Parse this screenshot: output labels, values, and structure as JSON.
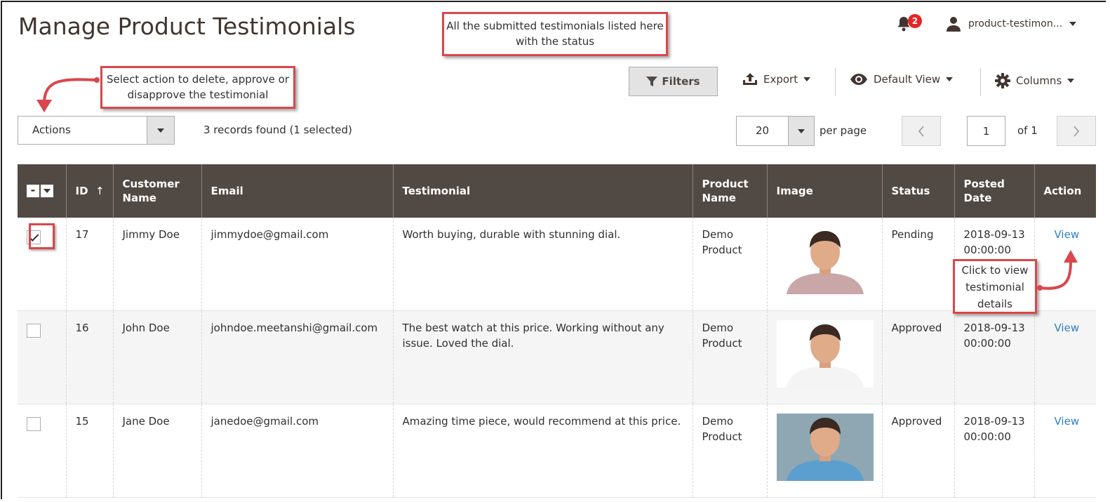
{
  "page_title": "Manage Product Testimonials",
  "notifications": {
    "count": "2"
  },
  "user": {
    "name": "product-testimon..."
  },
  "callouts": {
    "status_note": "All the submitted testimonials listed here with the status",
    "actions_note": "Select action to delete, approve or disapprove the testimonial",
    "view_note": "Click to view testimonial details"
  },
  "toolbar": {
    "filters_label": "Filters",
    "export_label": "Export",
    "view_label": "Default View",
    "columns_label": "Columns"
  },
  "actions": {
    "label": "Actions"
  },
  "records_text": "3 records found (1 selected)",
  "pagination": {
    "per_page_value": "20",
    "per_page_label": "per page",
    "current_page": "1",
    "of_label": "of 1"
  },
  "columns": [
    "ID",
    "Customer Name",
    "Email",
    "Testimonial",
    "Product Name",
    "Image",
    "Status",
    "Posted Date",
    "Action"
  ],
  "rows": [
    {
      "selected": true,
      "id": "17",
      "customer": "Jimmy Doe",
      "email": "jimmydoe@gmail.com",
      "testimonial": "Worth buying, durable with stunning dial.",
      "product": "Demo Product",
      "status": "Pending",
      "date": "2018-09-13 00:00:00",
      "action": "View",
      "shirt_color": "#c9a6a8",
      "bg_color": "#ffffff"
    },
    {
      "selected": false,
      "id": "16",
      "customer": "John Doe",
      "email": "johndoe.meetanshi@gmail.com",
      "testimonial": "The best watch at this price. Working without any issue. Loved the dial.",
      "product": "Demo Product",
      "status": "Approved",
      "date": "2018-09-13 00:00:00",
      "action": "View",
      "shirt_color": "#f4f4f4",
      "bg_color": "#ffffff"
    },
    {
      "selected": false,
      "id": "15",
      "customer": "Jane Doe",
      "email": "janedoe@gmail.com",
      "testimonial": "Amazing time piece, would recommend at this price.",
      "product": "Demo Product",
      "status": "Approved",
      "date": "2018-09-13 00:00:00",
      "action": "View",
      "shirt_color": "#5b9fcf",
      "bg_color": "#8fa7b3"
    }
  ]
}
